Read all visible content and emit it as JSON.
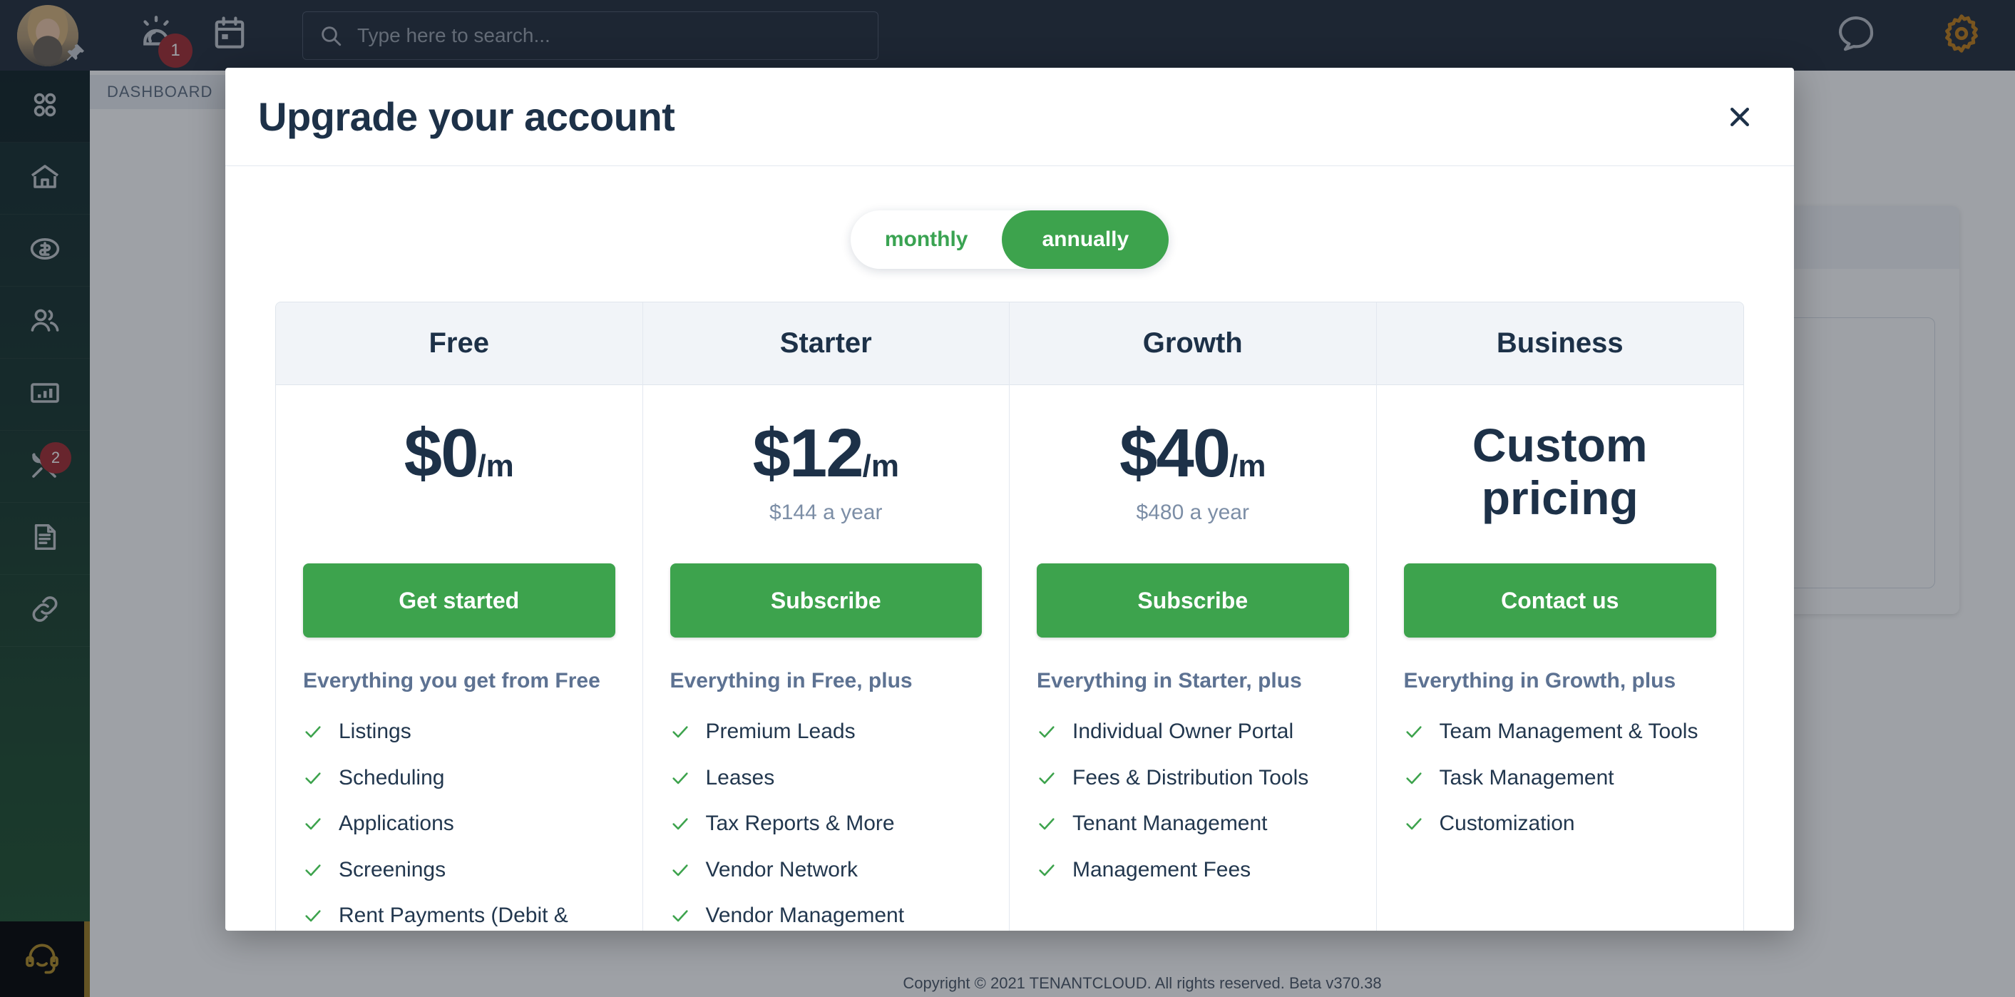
{
  "header": {
    "avatar_name": "user-avatar",
    "pin_icon": "pin-icon",
    "bell_icon": "alarm-bell-icon",
    "bell_badge": "1",
    "calendar_icon": "calendar-icon",
    "search": {
      "icon": "search-icon",
      "placeholder": "Type here to search...",
      "value": ""
    },
    "chat_icon": "chat-bubble-icon",
    "gear_icon": "gear-icon"
  },
  "sidebar": {
    "items": [
      {
        "icon": "apps-grid-icon",
        "name": "apps",
        "active": true,
        "badge": ""
      },
      {
        "icon": "home-icon",
        "name": "properties",
        "active": false,
        "badge": ""
      },
      {
        "icon": "dollar-coin-icon",
        "name": "accounting",
        "active": false,
        "badge": ""
      },
      {
        "icon": "people-icon",
        "name": "tenants",
        "active": false,
        "badge": ""
      },
      {
        "icon": "bar-chart-icon",
        "name": "reports",
        "active": false,
        "badge": ""
      },
      {
        "icon": "tools-icon",
        "name": "maintenance",
        "active": false,
        "badge": "2"
      },
      {
        "icon": "document-icon",
        "name": "documents",
        "active": false,
        "badge": ""
      },
      {
        "icon": "link-icon",
        "name": "links",
        "active": false,
        "badge": ""
      }
    ],
    "support_icon": "headset-support-icon"
  },
  "breadcrumb": {
    "label": "DASHBOARD",
    "chevron_icon": "chevron-right-icon"
  },
  "footer": {
    "copyright": "Copyright © 2021 TENANTCLOUD. All rights reserved. Beta v370.38"
  },
  "modal": {
    "title": "Upgrade your account",
    "close_icon": "close-icon",
    "billing_toggle": {
      "monthly_label": "monthly",
      "annually_label": "annually",
      "selected": "annually"
    },
    "plans": [
      {
        "name": "Free",
        "price": "$0",
        "price_suffix": "/m",
        "price_custom": "",
        "price_year": "",
        "cta": "Get started",
        "subhead": "Everything you get from Free",
        "features": [
          "Listings",
          "Scheduling",
          "Applications",
          "Screenings",
          "Rent Payments (Debit &"
        ]
      },
      {
        "name": "Starter",
        "price": "$12",
        "price_suffix": "/m",
        "price_custom": "",
        "price_year": "$144 a year",
        "cta": "Subscribe",
        "subhead": "Everything in Free, plus",
        "features": [
          "Premium Leads",
          "Leases",
          "Tax Reports & More",
          "Vendor Network",
          "Vendor Management"
        ]
      },
      {
        "name": "Growth",
        "price": "$40",
        "price_suffix": "/m",
        "price_custom": "",
        "price_year": "$480 a year",
        "cta": "Subscribe",
        "subhead": "Everything in Starter, plus",
        "features": [
          "Individual Owner Portal",
          "Fees & Distribution Tools",
          "Tenant Management",
          "Management Fees"
        ]
      },
      {
        "name": "Business",
        "price": "",
        "price_suffix": "",
        "price_custom": "Custom pricing",
        "price_year": "",
        "cta": "Contact us",
        "subhead": "Everything in Growth, plus",
        "features": [
          "Team Management & Tools",
          "Task Management",
          "Customization"
        ]
      }
    ]
  },
  "colors": {
    "accent_green": "#3da34d",
    "navy": "#1d3148",
    "header_bg": "#222c3a",
    "gear_orange": "#c07c17",
    "badge_red": "#a32a2f"
  }
}
